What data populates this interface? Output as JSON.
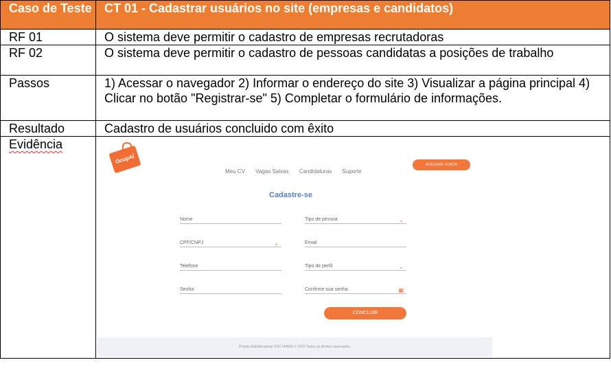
{
  "table": {
    "header": {
      "label": "Caso de Teste",
      "value": "CT 01 - Cadastrar usuários no site (empresas e candidatos)"
    },
    "rows": [
      {
        "label": "RF 01",
        "value": "O sistema deve permitir o cadastro de empresas recrutadoras"
      },
      {
        "label": "RF 02",
        "value": "O sistema deve permitir o cadastro de pessoas candidatas a posições de trabalho"
      },
      {
        "label": "Passos",
        "value": "1) Acessar o navegador 2) Informar o endereço do site 3) Visualizar a página principal 4) Clicar no botão \"Registrar-se\" 5) Completar o formulário de informações."
      },
      {
        "label": "Resultado",
        "value": "Cadastro de usuários concluido com êxito"
      },
      {
        "label": "Evidência"
      }
    ]
  },
  "evidence": {
    "logo_text": "OcupAÍ",
    "nav": [
      "Meu CV",
      "Vagas Salvas",
      "Candidaturas",
      "Suporte"
    ],
    "account_button": "ACESSAR CONTA",
    "form_title": "Cadastre-se",
    "fields": {
      "nome": "Nome",
      "tipo_pessoa": "Tipo de pessoa",
      "cpf_cnpj": "CPF/CNPJ",
      "email": "Email",
      "telefone": "Telefone",
      "tipo_perfil": "Tipo de perfil",
      "senha": "Senha",
      "confirme_senha": "Confirme sua senha"
    },
    "submit": "CONCLUIR",
    "footer": "Projeto Multidisciplinar PUC MINAS © 2022 Todos os direitos reservados.",
    "accent_color": "#f2773a"
  }
}
